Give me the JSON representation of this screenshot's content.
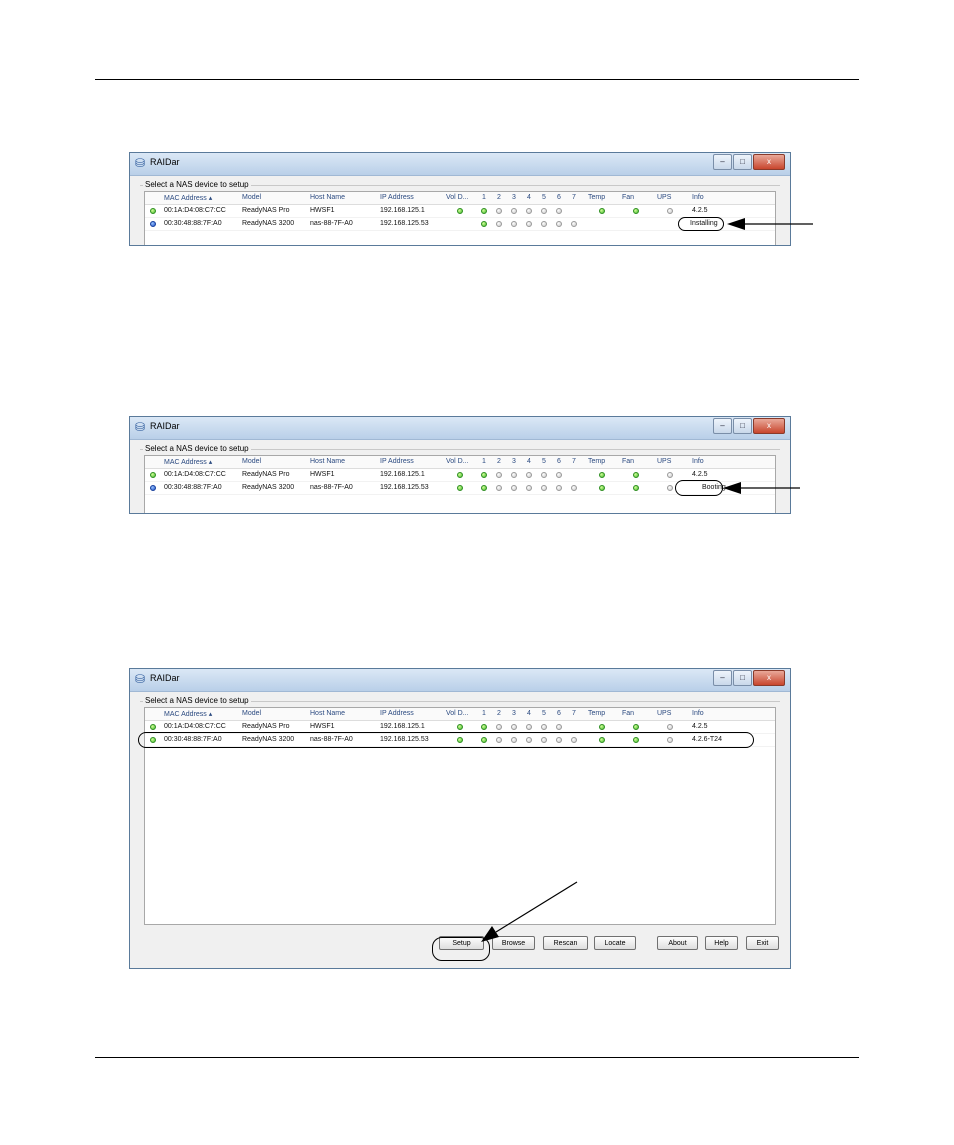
{
  "window": {
    "title": "RAIDar",
    "group_label": "Select a NAS device to setup",
    "controls": {
      "minimize": "–",
      "maximize": "□",
      "close": "x"
    }
  },
  "columns": [
    "MAC Address",
    "Model",
    "Host Name",
    "IP Address",
    "Vol D...",
    "1",
    "2",
    "3",
    "4",
    "5",
    "6",
    "7",
    "Temp",
    "Fan",
    "UPS",
    "Info"
  ],
  "sort_indicator": "▴",
  "rows": [
    {
      "mac": "00:1A:D4:08:C7:CC",
      "model": "ReadyNAS Pro",
      "host": "HWSF1",
      "ip": "192.168.125.1"
    },
    {
      "mac": "00:30:48:88:7F:A0",
      "model": "ReadyNAS 3200",
      "host": "nas-88-7F-A0",
      "ip": "192.168.125.53"
    }
  ],
  "screens": [
    {
      "row1_info": "4.2.5",
      "row2_info": "Installing"
    },
    {
      "row1_info": "4.2.5",
      "row2_info": "Booting"
    },
    {
      "row1_info": "4.2.5",
      "row2_info": "4.2.6-T24"
    }
  ],
  "buttons": {
    "setup": "Setup",
    "browse": "Browse",
    "rescan": "Rescan",
    "locate": "Locate",
    "about": "About",
    "help": "Help",
    "exit": "Exit"
  }
}
